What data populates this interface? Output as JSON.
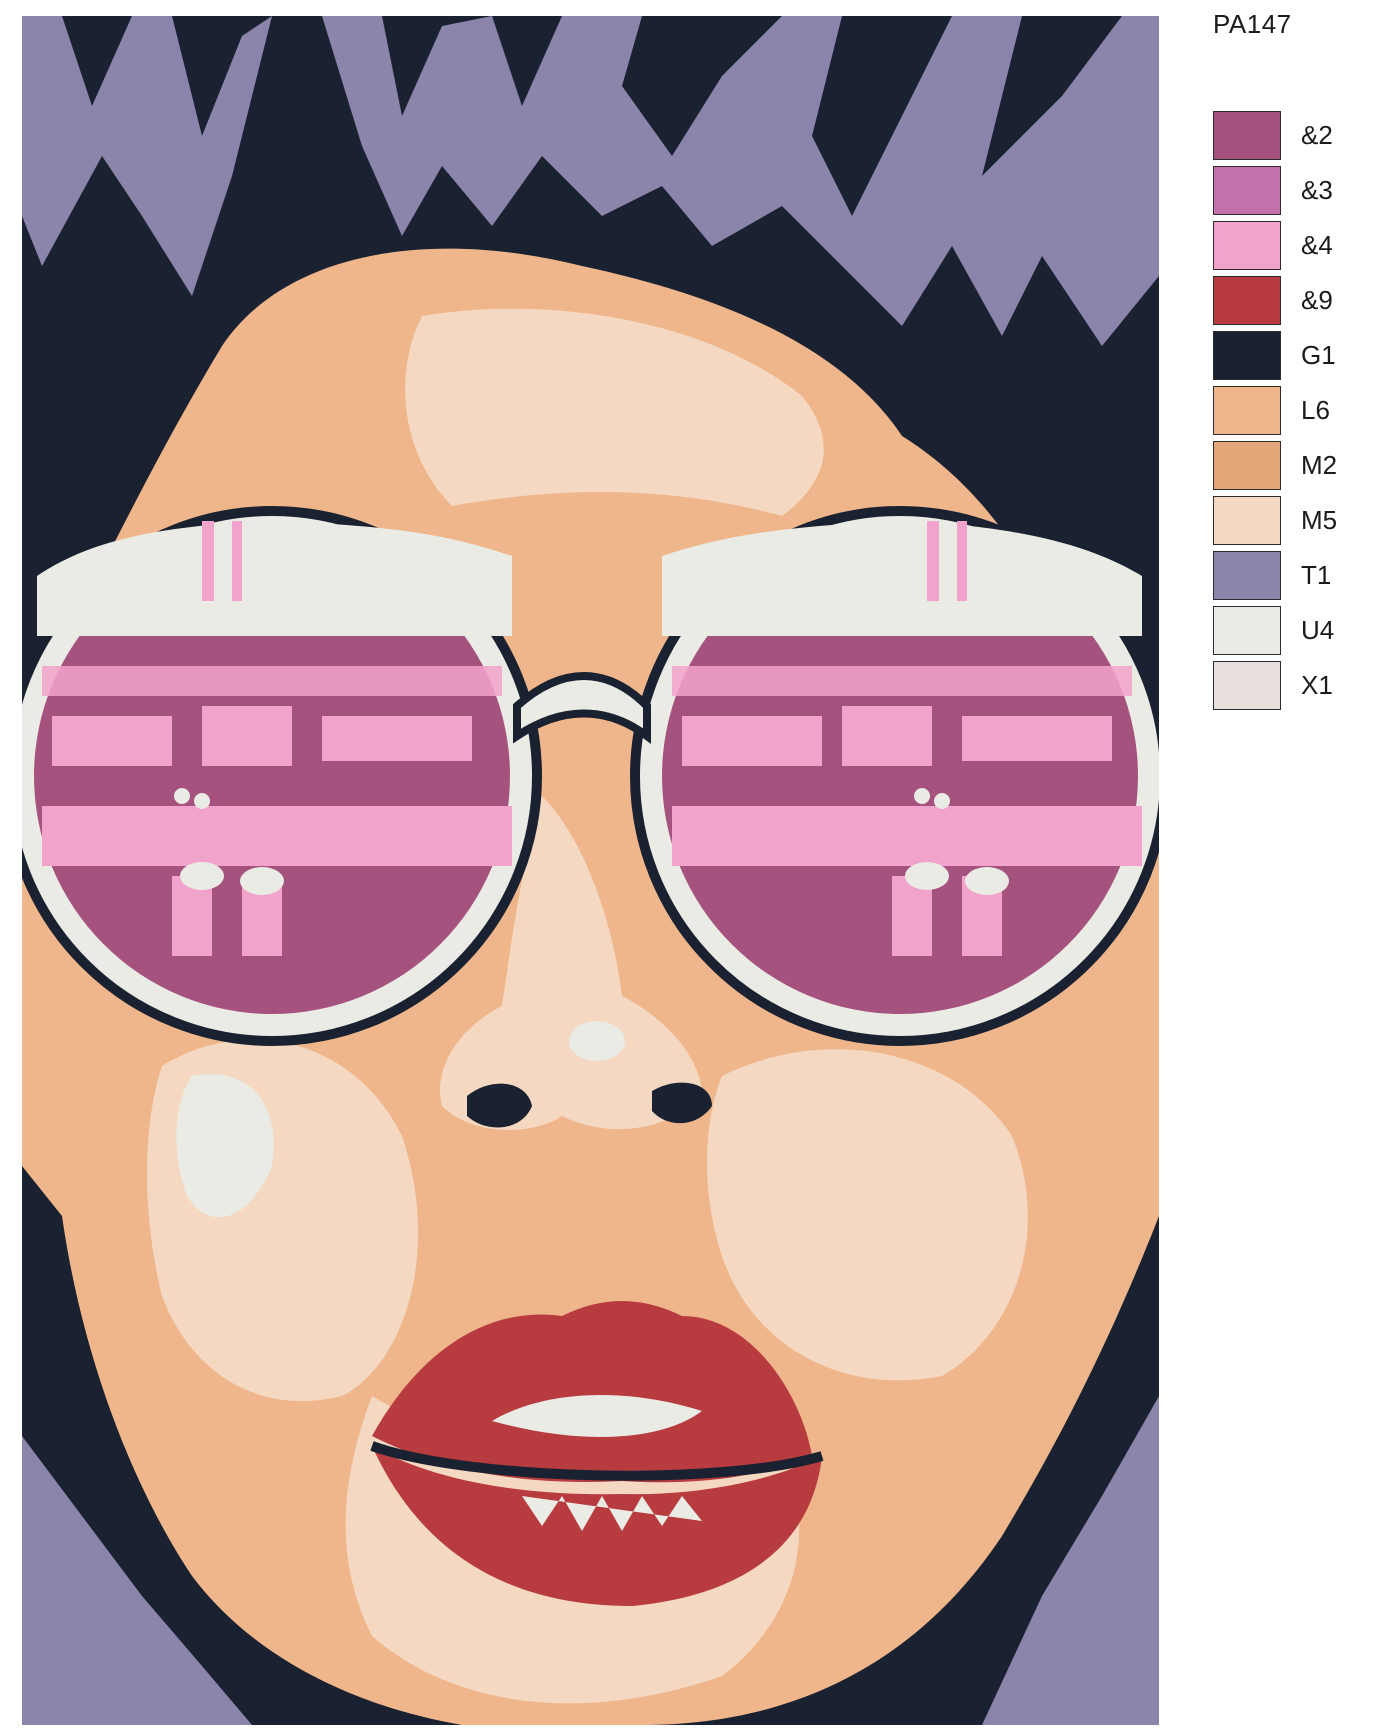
{
  "code": "PA147",
  "legend": [
    {
      "label": "&2",
      "color": "#a5527f"
    },
    {
      "label": "&3",
      "color": "#c273ad"
    },
    {
      "label": "&4",
      "color": "#f2a3cb"
    },
    {
      "label": "&9",
      "color": "#b83b3f"
    },
    {
      "label": "G1",
      "color": "#1a2130"
    },
    {
      "label": "L6",
      "color": "#f0b68b"
    },
    {
      "label": "M2",
      "color": "#e3a779"
    },
    {
      "label": "M5",
      "color": "#f4d8c1"
    },
    {
      "label": "T1",
      "color": "#8b84ab"
    },
    {
      "label": "U4",
      "color": "#e9ebe4"
    },
    {
      "label": "X1",
      "color": "#e8e0dc"
    }
  ]
}
